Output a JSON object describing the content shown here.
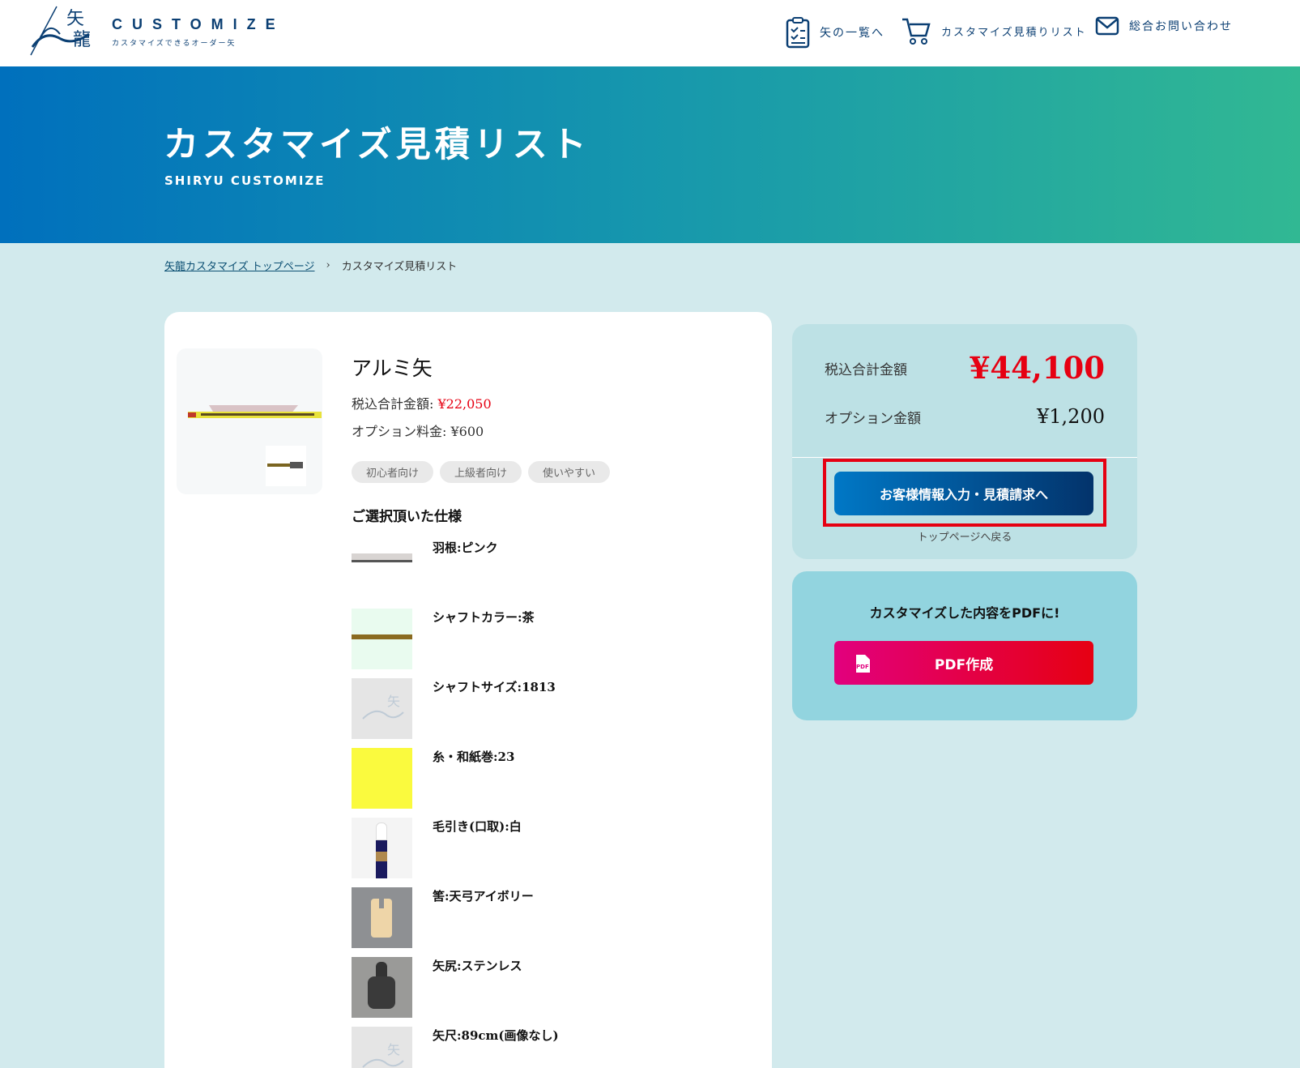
{
  "header": {
    "brand_title": "CUSTOMIZE",
    "brand_sub": "カスタマイズできるオーダー矢",
    "nav": {
      "arrow_list": "矢の一覧へ",
      "estimate_list": "カスタマイズ見積りリスト",
      "contact": "総合お問い合わせ"
    }
  },
  "hero": {
    "title": "カスタマイズ見積リスト",
    "subtitle": "SHIRYU CUSTOMIZE"
  },
  "breadcrumb": {
    "home": "矢龍カスタマイズ トップページ",
    "separator": "›",
    "current": "カスタマイズ見積リスト"
  },
  "product": {
    "name": "アルミ矢",
    "price_label": "税込合計金額:",
    "price_value": "¥22,050",
    "option_label": "オプション料金:",
    "option_value": "¥600",
    "tags": [
      "初心者向け",
      "上級者向け",
      "使いやすい"
    ],
    "spec_title": "ご選択頂いた仕様",
    "specs": [
      "羽根:ピンク",
      "シャフトカラー:茶",
      "シャフトサイズ:1813",
      "糸・和紙巻:23",
      "毛引き(口取):白",
      "筈:天弓アイボリー",
      "矢尻:ステンレス",
      "矢尺:89cm(画像なし)"
    ]
  },
  "summary": {
    "total_label": "税込合計金額",
    "total_value": "¥44,100",
    "option_label": "オプション金額",
    "option_value": "¥1,200",
    "cta_label": "お客様情報入力・見積請求へ",
    "back_link": "トップページへ戻る"
  },
  "pdf": {
    "title": "カスタマイズした内容をPDFに!",
    "button_label": "PDF作成",
    "icon_text": "PDF"
  },
  "colors": {
    "accent_red": "#e60012",
    "brand_blue": "#0b3f73"
  }
}
